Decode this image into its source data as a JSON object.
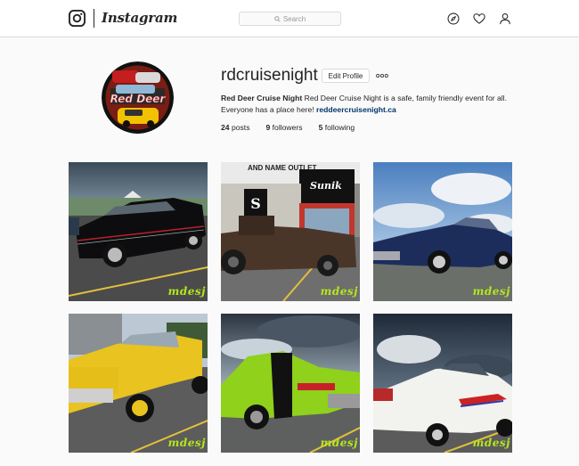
{
  "header": {
    "logo_icon": "instagram-camera-icon",
    "wordmark": "Instagram",
    "search_placeholder": "Search",
    "icons": [
      "compass-icon",
      "heart-icon",
      "person-icon"
    ]
  },
  "profile": {
    "username": "rdcruisenight",
    "edit_label": "Edit Profile",
    "more_icon": "ellipsis-icon",
    "bio_name": "Red Deer Cruise Night",
    "bio_text": " Red Deer Cruise Night is a safe, family friendly event for all. Everyone has a place here! ",
    "bio_link": "reddeercruisenight.ca",
    "stats": {
      "posts_count": "24",
      "posts_label": " posts",
      "followers_count": "9",
      "followers_label": " followers",
      "following_count": "5",
      "following_label": " following"
    }
  },
  "posts": [
    {
      "watermark": "mdesj"
    },
    {
      "watermark": "mdesj",
      "sign_top": "AND NAME OUTLET",
      "sign_store": "Sunik"
    },
    {
      "watermark": "mdesj"
    },
    {
      "watermark": "mdesj"
    },
    {
      "watermark": "mdesj"
    },
    {
      "watermark": "mdesj"
    }
  ],
  "colors": {
    "link": "#003569",
    "border": "#dbdbdb",
    "watermark": "#b5e61d"
  }
}
